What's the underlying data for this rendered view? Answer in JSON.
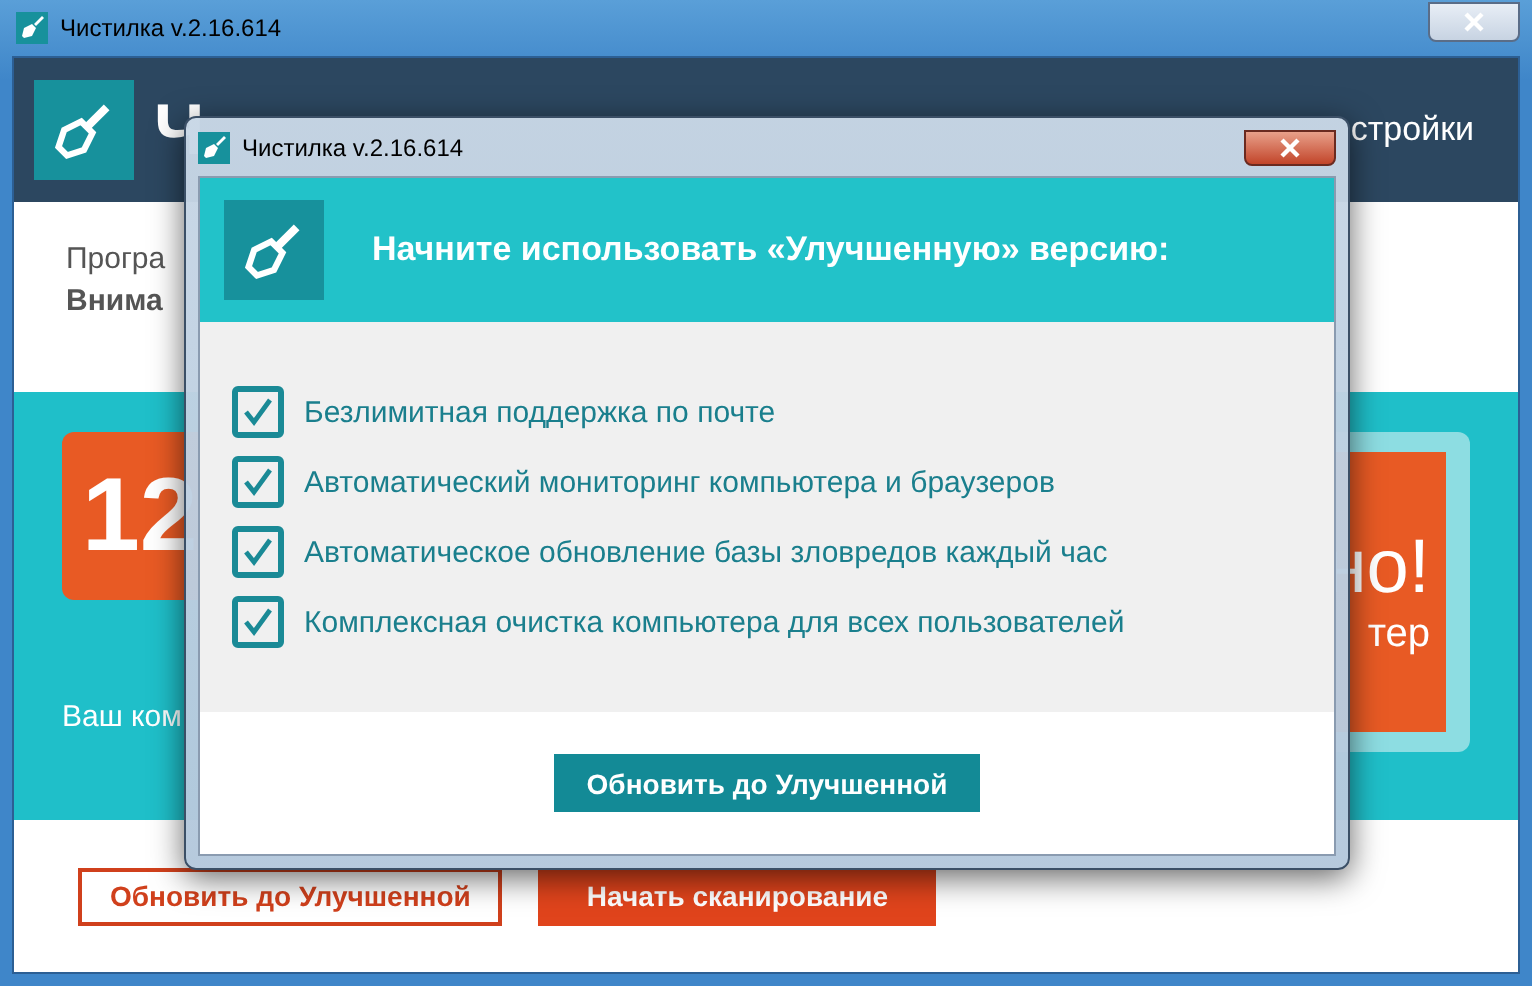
{
  "window": {
    "title": "Чистилка v.2.16.614"
  },
  "background_app": {
    "logo_text": "Ч",
    "settings_link": "стройки",
    "notice_line_1": "Програ",
    "notice_line_2": "Внима",
    "count": "12",
    "promo_title": "но!",
    "promo_subtitle": "тер",
    "status_text": "Ваш ком",
    "buttons": [
      {
        "label": "Обновить до Улучшенной",
        "kind": "outline"
      },
      {
        "label": "Начать сканирование",
        "kind": "filled"
      }
    ]
  },
  "dialog": {
    "title": "Чистилка v.2.16.614",
    "heading": "Начните использовать «Улучшенную» версию:",
    "features": [
      {
        "label": "Безлимитная поддержка по почте",
        "checked": true
      },
      {
        "label": "Автоматический мониторинг компьютера и браузеров",
        "checked": true
      },
      {
        "label": "Автоматическое обновление базы зловредов каждый час",
        "checked": true
      },
      {
        "label": "Комплексная очистка компьютера для всех пользователей",
        "checked": true
      }
    ],
    "button": "Обновить до Улучшенной"
  }
}
